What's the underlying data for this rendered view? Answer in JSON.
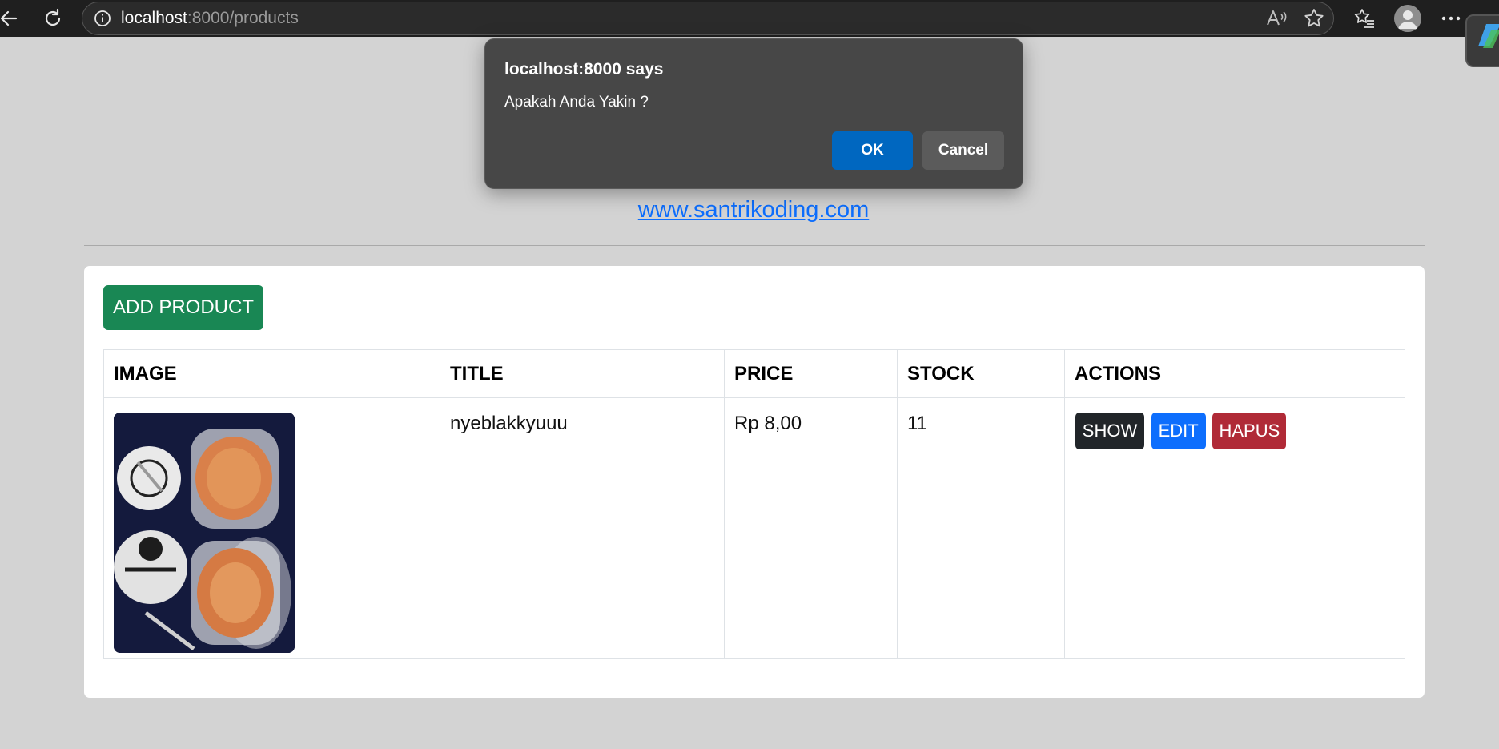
{
  "browser": {
    "url_host": "localhost",
    "url_path": ":8000/products",
    "icons": [
      "back-icon",
      "reload-icon",
      "site-info-icon",
      "read-aloud-icon",
      "favorite-star-icon",
      "favorites-list-icon",
      "profile-icon",
      "more-menu-icon"
    ]
  },
  "page": {
    "site_link": "www.santrikoding.com",
    "add_button": "ADD PRODUCT",
    "table": {
      "headers": [
        "IMAGE",
        "TITLE",
        "PRICE",
        "STOCK",
        "ACTIONS"
      ],
      "rows": [
        {
          "title": "nyeblakkyuuu",
          "price": "Rp 8,00",
          "stock": "11",
          "actions": {
            "show": "SHOW",
            "edit": "EDIT",
            "delete": "HAPUS"
          }
        }
      ]
    }
  },
  "dialog": {
    "title": "localhost:8000 says",
    "message": "Apakah Anda Yakin ?",
    "ok": "OK",
    "cancel": "Cancel"
  },
  "colors": {
    "page_bg": "#d3d3d3",
    "add_button": "#198754",
    "show_button": "#212529",
    "edit_button": "#0d6efd",
    "delete_button": "#b02a37",
    "dialog_ok": "#0067c0"
  }
}
